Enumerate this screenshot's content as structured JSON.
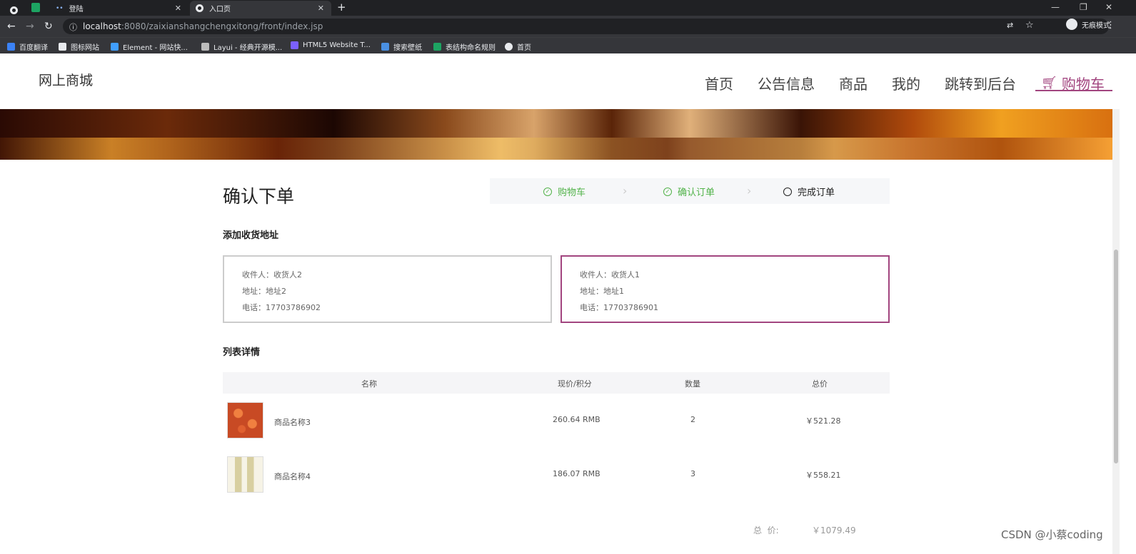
{
  "browser": {
    "tabs": [
      {
        "label": "登陆"
      },
      {
        "label": "入口页"
      }
    ],
    "url_host": "localhost",
    "url_rest": ":8080/zaixianshangchengxitong/front/index.jsp",
    "incognito_label": "无痕模式",
    "bookmarks": [
      "百度翻译",
      "图标网站",
      "Element - 网站快...",
      "Layui - 经典开源模...",
      "HTML5 Website T...",
      "搜索壁纸",
      "表结构命名规则",
      "首页"
    ]
  },
  "site": {
    "name": "网上商城",
    "nav": [
      "首页",
      "公告信息",
      "商品",
      "我的",
      "跳转到后台",
      "购物车"
    ]
  },
  "checkout": {
    "title": "确认下单",
    "steps": [
      {
        "label": "购物车",
        "status": "done"
      },
      {
        "label": "确认订单",
        "status": "done"
      },
      {
        "label": "完成订单",
        "status": "current"
      }
    ],
    "address_section_title": "添加收货地址",
    "addresses": [
      {
        "receiver": "收件人：收货人2",
        "address": "地址：地址2",
        "phone": "电话：17703786902",
        "selected": false
      },
      {
        "receiver": "收件人：收货人1",
        "address": "地址：地址1",
        "phone": "电话：17703786901",
        "selected": true
      }
    ],
    "list_section_title": "列表详情",
    "table_headers": [
      "名称",
      "现价/积分",
      "数量",
      "总价"
    ],
    "items": [
      {
        "name": "商品名称3",
        "price": "260.64 RMB",
        "qty": "2",
        "total": "￥521.28",
        "thumb_color": "#c84a24"
      },
      {
        "name": "商品名称4",
        "price": "186.07 RMB",
        "qty": "3",
        "total": "￥558.21",
        "thumb_color": "#e8e2c8"
      }
    ],
    "total_label": "总  价:",
    "total_value": "￥1079.49"
  },
  "watermark": "CSDN @小蔡coding",
  "colors": {
    "accent": "#a2457f",
    "done": "#52b34a"
  }
}
